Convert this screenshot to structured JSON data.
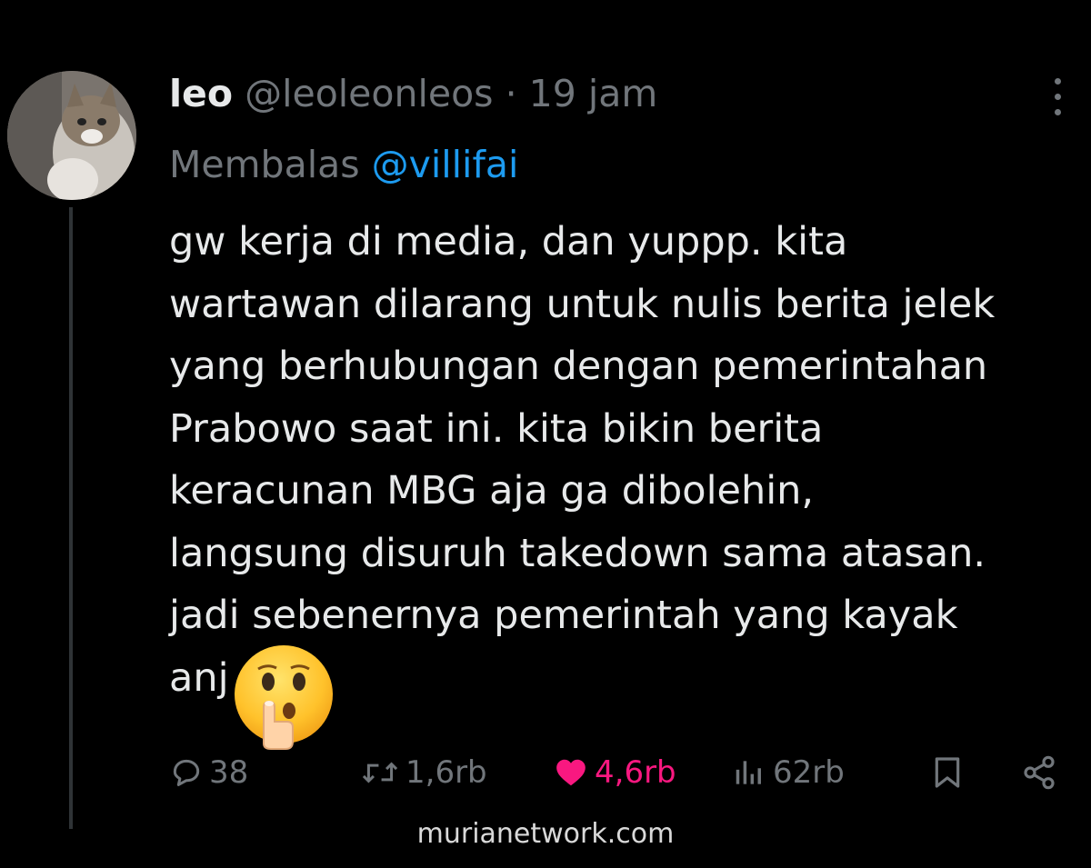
{
  "post": {
    "display_name": "leo",
    "handle": "@leoleonleos",
    "separator": "·",
    "time": "19 jam",
    "replying_prefix": "Membalas",
    "replying_to": "@villifai",
    "text_lines": [
      "gw kerja di media, dan yuppp. kita",
      "wartawan dilarang untuk nulis berita jelek",
      "yang berhubungan dengan pemerintahan",
      "Prabowo saat ini. kita bikin berita",
      "keracunan MBG aja ga dibolehin,",
      "langsung disuruh takedown sama atasan.",
      "jadi sebenernya pemerintah yang kayak",
      "anj"
    ],
    "emoji": "shushing-face"
  },
  "actions": {
    "replies": "38",
    "reposts": "1,6rb",
    "likes": "4,6rb",
    "views": "62rb",
    "like_color": "#f91880",
    "icons": [
      "reply-icon",
      "repost-icon",
      "heart-icon",
      "views-icon",
      "bookmark-icon",
      "share-icon",
      "more-icon"
    ]
  },
  "watermark": "murianetwork.com",
  "colors": {
    "background": "#000000",
    "text": "#e7e9ea",
    "muted": "#71767b",
    "mention": "#1d9bf0"
  }
}
